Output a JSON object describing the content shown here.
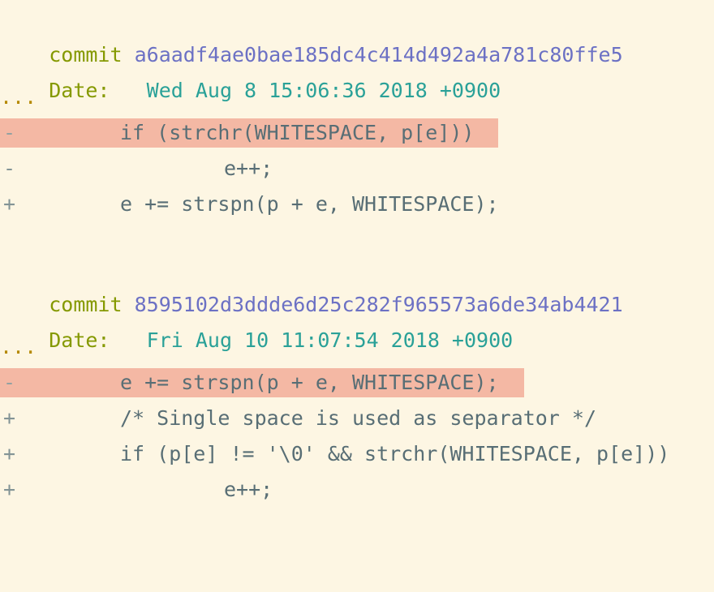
{
  "log": [
    {
      "commit_keyword": "commit",
      "hash": "a6aadf4ae0bae185dc4c414d492a4a781c80ffe5",
      "date_keyword": "Date:",
      "date_value": "Wed Aug 8 15:06:36 2018 +0900",
      "ellipsis": "...",
      "diff": [
        {
          "sign": "-",
          "text": "if (strchr(WHITESPACE, p[e]))",
          "indent": 1,
          "highlighted": true
        },
        {
          "sign": "-",
          "text": "e++;",
          "indent": 2,
          "highlighted": false
        },
        {
          "sign": "+",
          "text": "e += strspn(p + e, WHITESPACE);",
          "indent": 1,
          "highlighted": false
        }
      ]
    },
    {
      "commit_keyword": "commit",
      "hash": "8595102d3ddde6d25c282f965573a6de34ab4421",
      "date_keyword": "Date:",
      "date_value": "Fri Aug 10 11:07:54 2018 +0900",
      "ellipsis": "...",
      "diff": [
        {
          "sign": "-",
          "text": "e += strspn(p + e, WHITESPACE);",
          "indent": 1,
          "highlighted": true
        },
        {
          "sign": "+",
          "text": "/* Single space is used as separator */",
          "indent": 1,
          "highlighted": false
        },
        {
          "sign": "+",
          "text": "if (p[e] != '\\0' && strchr(WHITESPACE, p[e]))",
          "indent": 1,
          "highlighted": false
        },
        {
          "sign": "+",
          "text": "e++;",
          "indent": 2,
          "highlighted": false
        }
      ]
    }
  ],
  "colors": {
    "background": "#fdf6e3",
    "keyword": "#859900",
    "hash": "#6c71c4",
    "date": "#2aa198",
    "ellipsis": "#b58900",
    "removed_highlight": "#f4b8a4",
    "code_text": "#586e75"
  }
}
